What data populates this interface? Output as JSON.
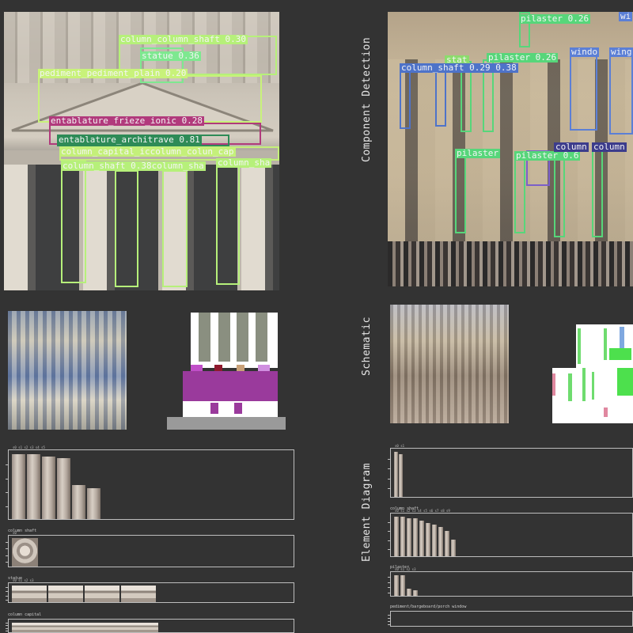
{
  "section_labels": {
    "component_detection": "Component Detection",
    "schematic": "Schematic",
    "element_diagram": "Element Diagram"
  },
  "left_detections": [
    {
      "text": "column_column_shaft 0.30",
      "color": "#b6f07a"
    },
    {
      "text": "statue 0.36",
      "color": "#7ee890"
    },
    {
      "text": "pediment_pediment_plain 0.20",
      "color": "#c8f27a"
    },
    {
      "text": "entablature_frieze_ionic 0.28",
      "color": "#b13a7c"
    },
    {
      "text": "entablature_architrave 0.81",
      "color": "#2e8b57"
    },
    {
      "text": "column_capital_iccolumn_colun_cap",
      "color": "#c4f07a"
    },
    {
      "text": "column_shaft 0.38column_sha",
      "color": "#b6f07a"
    },
    {
      "text": "column_sha",
      "color": "#b6f07a"
    }
  ],
  "right_detections": [
    {
      "text": "pilaster 0.26",
      "color": "#57d67a"
    },
    {
      "text": "wi",
      "color": "#5b7fd6"
    },
    {
      "text": "pilaster 0.26",
      "color": "#57d67a"
    },
    {
      "text": "windo",
      "color": "#5b7fd6"
    },
    {
      "text": "wing",
      "color": "#5b7fd6"
    },
    {
      "text": "stat",
      "color": "#8bdc6c"
    },
    {
      "text": "column_shaft 0.29 0.38",
      "color": "#4e73c9"
    },
    {
      "text": "pilaster",
      "color": "#57d67a"
    },
    {
      "text": "pilaster 0.6",
      "color": "#57d67a"
    },
    {
      "text": "column",
      "color": "#3c3c8c"
    },
    {
      "text": "column",
      "color": "#3c3c8c"
    }
  ],
  "left_strips": [
    {
      "title": "",
      "ticks": "s0 s1 s2 s3 s4 s5",
      "kind": "shaft",
      "bars": [
        0.95,
        0.95,
        0.92,
        0.9,
        0.5,
        0.45
      ]
    },
    {
      "title": "column shaft",
      "ticks": "s0",
      "kind": "orn",
      "bars": [
        0.95
      ]
    },
    {
      "title": "statue",
      "ticks": "s0 s1 s2 s3",
      "kind": "cap",
      "bars": [
        0.9,
        0.9,
        0.9,
        0.9
      ]
    },
    {
      "title": "column capital",
      "ticks": "",
      "kind": "cap",
      "bars": [
        0.8
      ]
    }
  ],
  "right_strips": [
    {
      "title": "",
      "ticks": "s0 s1",
      "kind": "shaft",
      "bars": [
        0.95,
        0.9
      ]
    },
    {
      "title": "column shaft",
      "ticks": "s0 s1 s2 s3 s4 s5 s6 s7 s8 s9",
      "kind": "shaft",
      "bars": [
        0.95,
        0.95,
        0.9,
        0.9,
        0.85,
        0.8,
        0.75,
        0.7,
        0.6,
        0.4
      ]
    },
    {
      "title": "pilaster",
      "ticks": "s0 s1 s2 s3",
      "kind": "shaft",
      "bars": [
        0.9,
        0.9,
        0.3,
        0.25
      ]
    },
    {
      "title": "pediment/bargeboard/porch window",
      "ticks": "",
      "kind": "shaft",
      "bars": []
    }
  ]
}
